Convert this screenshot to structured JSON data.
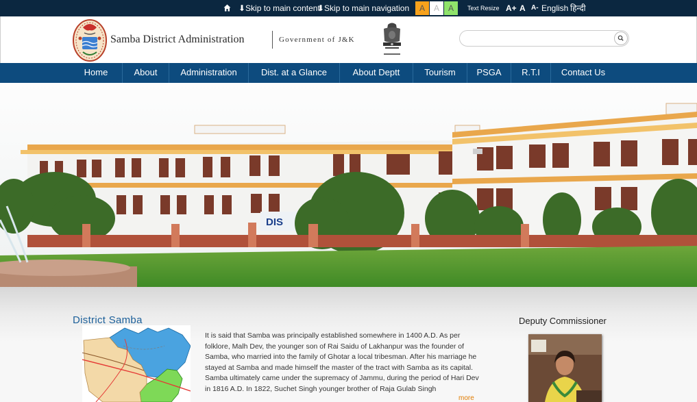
{
  "topbar": {
    "home_icon": "home-icon",
    "skip_main": "⬇Skip to main content",
    "skip_nav": "⬇Skip to main navigation",
    "contrast": [
      "A",
      "A",
      "A"
    ],
    "text_resize": "Text Resize",
    "font_plus": "A+",
    "font_normal": "A",
    "font_minus": "A-",
    "lang_en": "English",
    "lang_hi": "हिन्दी"
  },
  "header": {
    "title": "Samba District Administration",
    "subtitle": "Government of J&K",
    "search_placeholder": ""
  },
  "nav": {
    "items": [
      "Home",
      "About",
      "Administration",
      "Dist. at a Glance",
      "About Deptt",
      "Tourism",
      "PSGA",
      "R.T.I",
      "Contact Us"
    ]
  },
  "banner": {
    "sign_text": "DIS"
  },
  "main": {
    "section_title": "District Samba",
    "description": "It is said that Samba was principally established somewhere in 1400 A.D. As per folklore, Malh Dev, the younger son of Rai Saidu of Lakhanpur was the founder of Samba, who married into the family of Ghotar a local tribesman. After his marriage he stayed at Samba and made himself the master of the tract with Samba as its capital. Samba ultimately came under the supremacy of Jammu, during the period of Hari Dev in 1816 A.D. In 1822, Suchet Singh younger brother of Raja Gulab Singh",
    "more_link": "more"
  },
  "sidebar": {
    "dc_title": "Deputy Commissioner"
  },
  "colors": {
    "topbar_bg": "#0b2740",
    "nav_bg": "#0d4b7e",
    "contrast_orange": "#f7a21c",
    "contrast_white": "#ffffff",
    "contrast_green": "#8fe36b",
    "title_blue": "#1b5f99",
    "more_orange": "#e07b00"
  }
}
